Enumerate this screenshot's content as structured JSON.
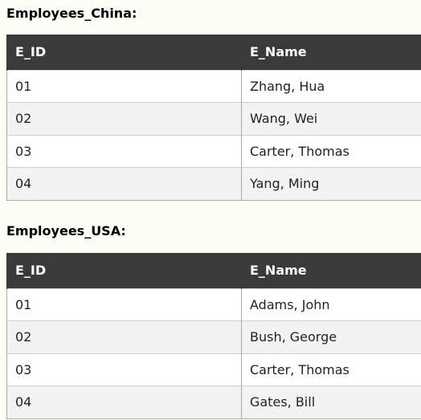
{
  "tables": [
    {
      "title": "Employees_China:",
      "headers": [
        "E_ID",
        "E_Name"
      ],
      "rows": [
        [
          "01",
          "Zhang, Hua"
        ],
        [
          "02",
          "Wang, Wei"
        ],
        [
          "03",
          "Carter, Thomas"
        ],
        [
          "04",
          "Yang, Ming"
        ]
      ]
    },
    {
      "title": "Employees_USA:",
      "headers": [
        "E_ID",
        "E_Name"
      ],
      "rows": [
        [
          "01",
          "Adams, John"
        ],
        [
          "02",
          "Bush, George"
        ],
        [
          "03",
          "Carter, Thomas"
        ],
        [
          "04",
          "Gates, Bill"
        ]
      ]
    }
  ]
}
